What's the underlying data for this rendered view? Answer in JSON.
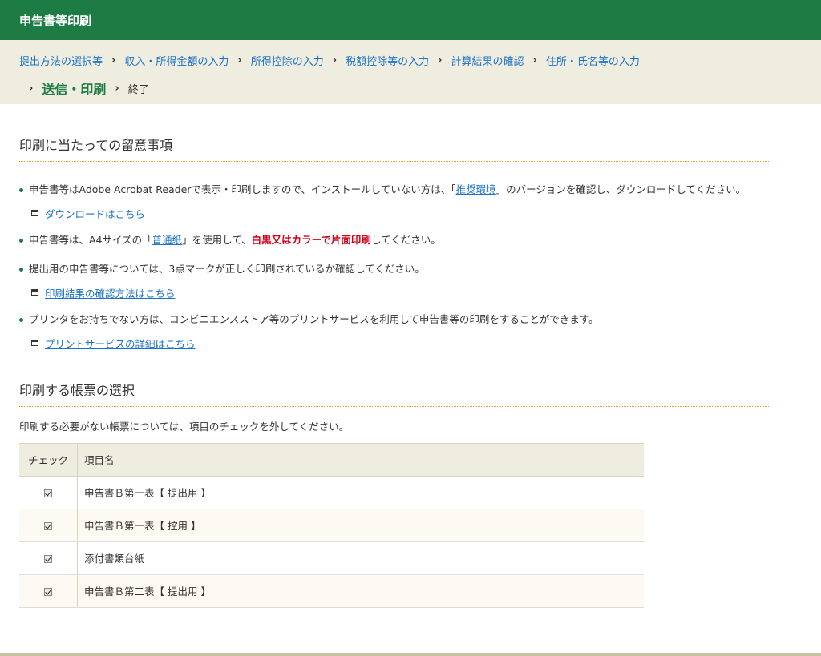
{
  "header": {
    "title": "申告書等印刷"
  },
  "breadcrumb": {
    "steps": [
      "提出方法の選択等",
      "収入・所得金額の入力",
      "所得控除の入力",
      "税額控除等の入力",
      "計算結果の確認",
      "住所・氏名等の入力"
    ],
    "current": "送信・印刷",
    "last": "終了",
    "separator": "›"
  },
  "notes_section": {
    "title": "印刷に当たっての留意事項",
    "items": [
      {
        "pre": "申告書等はAdobe Acrobat Readerで表示・印刷しますので、インストールしていない方は、「",
        "link": "推奨環境",
        "post": "」のバージョンを確認し、ダウンロードしてください。",
        "sublink": "ダウンロードはこちら"
      },
      {
        "pre": "申告書等は、A4サイズの「",
        "link": "普通紙",
        "mid": "」を使用して、",
        "emphasis": "白黒又はカラーで片面印刷",
        "post": "してください。"
      },
      {
        "text": "提出用の申告書等については、3点マークが正しく印刷されているか確認してください。",
        "sublink": "印刷結果の確認方法はこちら"
      },
      {
        "text": "プリンタをお持ちでない方は、コンビニエンスストア等のプリントサービスを利用して申告書等の印刷をすることができます。",
        "sublink": "プリントサービスの詳細はこちら"
      }
    ]
  },
  "forms_section": {
    "title": "印刷する帳票の選択",
    "instruction": "印刷する必要がない帳票については、項目のチェックを外してください。",
    "columns": {
      "check": "チェック",
      "name": "項目名"
    },
    "rows": [
      {
        "name": "申告書Ｂ第一表【 提出用 】",
        "checked": true
      },
      {
        "name": "申告書Ｂ第一表【 控用 】",
        "checked": true
      },
      {
        "name": "添付書類台紙",
        "checked": true
      },
      {
        "name": "申告書Ｂ第二表【 提出用 】",
        "checked": true
      }
    ]
  },
  "colors": {
    "header_bg": "#1d7c43",
    "breadcrumb_bg": "#efece0",
    "link": "#1a73c4",
    "emphasis": "#d0021b"
  }
}
